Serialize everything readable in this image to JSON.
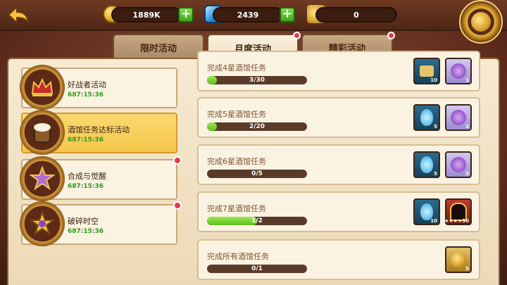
{
  "resources": [
    {
      "name": "gold",
      "value": "1889K"
    },
    {
      "name": "diamond",
      "value": "2439"
    },
    {
      "name": "key",
      "value": "0"
    }
  ],
  "tabs": [
    {
      "label": "限时活动",
      "active": false,
      "dot": false
    },
    {
      "label": "月度活动",
      "active": true,
      "dot": true
    },
    {
      "label": "精彩活动",
      "active": false,
      "dot": true
    }
  ],
  "activities": [
    {
      "title": "好战者活动",
      "time": "687:15:36",
      "icon": "crown-icon",
      "active": false,
      "dot": false
    },
    {
      "title": "酒馆任务达标活动",
      "time": "687:15:36",
      "icon": "beer-barrel-icon",
      "active": true,
      "dot": false
    },
    {
      "title": "合成与觉醒",
      "time": "687:15:36",
      "icon": "star-emblem-icon",
      "active": false,
      "dot": true
    },
    {
      "title": "破碎时空",
      "time": "687:15:36",
      "icon": "broken-star-icon",
      "active": false,
      "dot": true
    }
  ],
  "tasks": [
    {
      "title": "完成4星酒馆任务",
      "progress": "3/30",
      "fill_fraction": 0.1,
      "rewards": [
        {
          "icon": "scroll-icon",
          "count": "10",
          "style": "rw-blue"
        },
        {
          "icon": "purple-gem-icon",
          "count": "1",
          "style": "rw-purple"
        }
      ]
    },
    {
      "title": "完成5星酒馆任务",
      "progress": "2/20",
      "fill_fraction": 0.1,
      "rewards": [
        {
          "icon": "blue-flame-icon",
          "count": "5",
          "style": "rw-blue"
        },
        {
          "icon": "purple-gem-icon",
          "count": "2",
          "style": "rw-purple"
        }
      ]
    },
    {
      "title": "完成6星酒馆任务",
      "progress": "0/5",
      "fill_fraction": 0.0,
      "rewards": [
        {
          "icon": "blue-flame-icon",
          "count": "5",
          "style": "rw-blue"
        },
        {
          "icon": "purple-gem-icon",
          "count": "3",
          "style": "rw-purple"
        }
      ]
    },
    {
      "title": "完成7星酒馆任务",
      "progress": "1/2",
      "fill_fraction": 0.5,
      "rewards": [
        {
          "icon": "blue-flame-icon",
          "count": "10",
          "style": "rw-blue"
        },
        {
          "icon": "hero-card-icon",
          "count": "★★★★50",
          "style": "rw-red"
        }
      ]
    },
    {
      "title": "完成所有酒馆任务",
      "progress": "0/1",
      "fill_fraction": 0.0,
      "rewards": [
        {
          "icon": "key-icon",
          "count": "5",
          "style": "rw-gold"
        }
      ]
    }
  ],
  "colors": {
    "accent_green": "#5fbe22",
    "timer_green": "#2e9c1c",
    "alert_red": "#e7394b"
  }
}
